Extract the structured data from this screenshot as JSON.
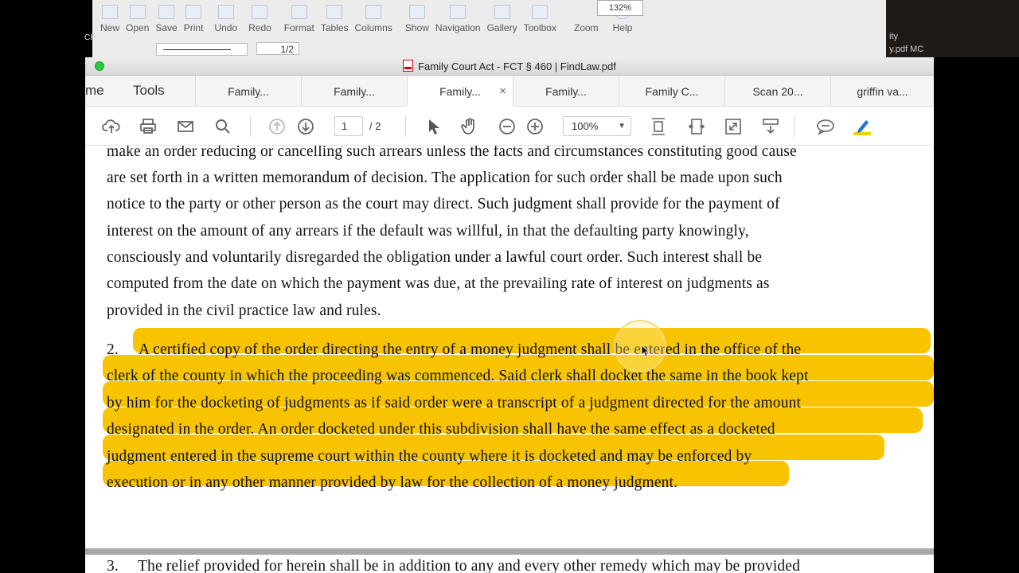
{
  "background_app": {
    "toolbar": [
      {
        "label": "New"
      },
      {
        "label": "Open"
      },
      {
        "label": "Save"
      },
      {
        "label": "Print"
      },
      {
        "label": "Undo"
      },
      {
        "label": "Redo"
      },
      {
        "label": "Format"
      },
      {
        "label": "Tables"
      },
      {
        "label": "Columns"
      },
      {
        "label": "Show"
      },
      {
        "label": "Navigation"
      },
      {
        "label": "Gallery"
      },
      {
        "label": "Toolbox"
      },
      {
        "label": "Zoom"
      },
      {
        "label": "Help"
      }
    ],
    "zoom_value": "132%",
    "page_indicator": "1/2",
    "right_text_1": "ity",
    "right_text_2": "y.pdf  MC",
    "left_text": "CH"
  },
  "window": {
    "title": "Family Court Act - FCT § 460 | FindLaw.pdf",
    "home_tab": "me",
    "tools_tab": "Tools",
    "tabs": [
      {
        "label": "Family...",
        "active": false
      },
      {
        "label": "Family...",
        "active": false
      },
      {
        "label": "Family...",
        "active": true
      },
      {
        "label": "Family...",
        "active": false
      },
      {
        "label": "Family C...",
        "active": false
      },
      {
        "label": "Scan 20...",
        "active": false
      },
      {
        "label": "griffin va...",
        "active": false
      }
    ],
    "close_glyph": "×",
    "page_current": "1",
    "page_total": "/ 2",
    "zoom": "100%"
  },
  "document": {
    "lines": [
      "make an order reducing or cancelling such arrears unless the facts and circumstances constituting good cause",
      "are set forth in a written memorandum of decision.   The application for such order shall be made upon such",
      "notice to the party or other person as the court may direct.   Such judgment shall provide for the payment of",
      "interest on the amount of any arrears if the default was willful, in that the defaulting party knowingly,",
      "consciously and voluntarily disregarded the obligation under a lawful court order.   Such interest shall be",
      "computed from the date on which the payment was due, at the prevailing rate of interest on judgments as",
      "provided in the civil practice law and rules."
    ],
    "para2_number": "2.",
    "para2_lines": [
      "A certified copy of the order directing the entry of a money judgment shall be entered in the office of the",
      "clerk of the county in which the proceeding was commenced.   Said clerk shall docket the same in the book kept",
      "by him for the docketing of judgments as if said order were a transcript of a judgment directed for the amount",
      "designated in the order.   An order docketed under this subdivision shall have the same effect as a docketed",
      "judgment entered in the supreme court within the county where it is docketed and may be enforced by",
      "execution or in any other manner provided by law for the collection of a money judgment."
    ],
    "para3_number": "3.",
    "para3_line": "The relief provided for herein shall be in addition to any and every other remedy which may be provided",
    "highlight_color": "#f8c300"
  }
}
